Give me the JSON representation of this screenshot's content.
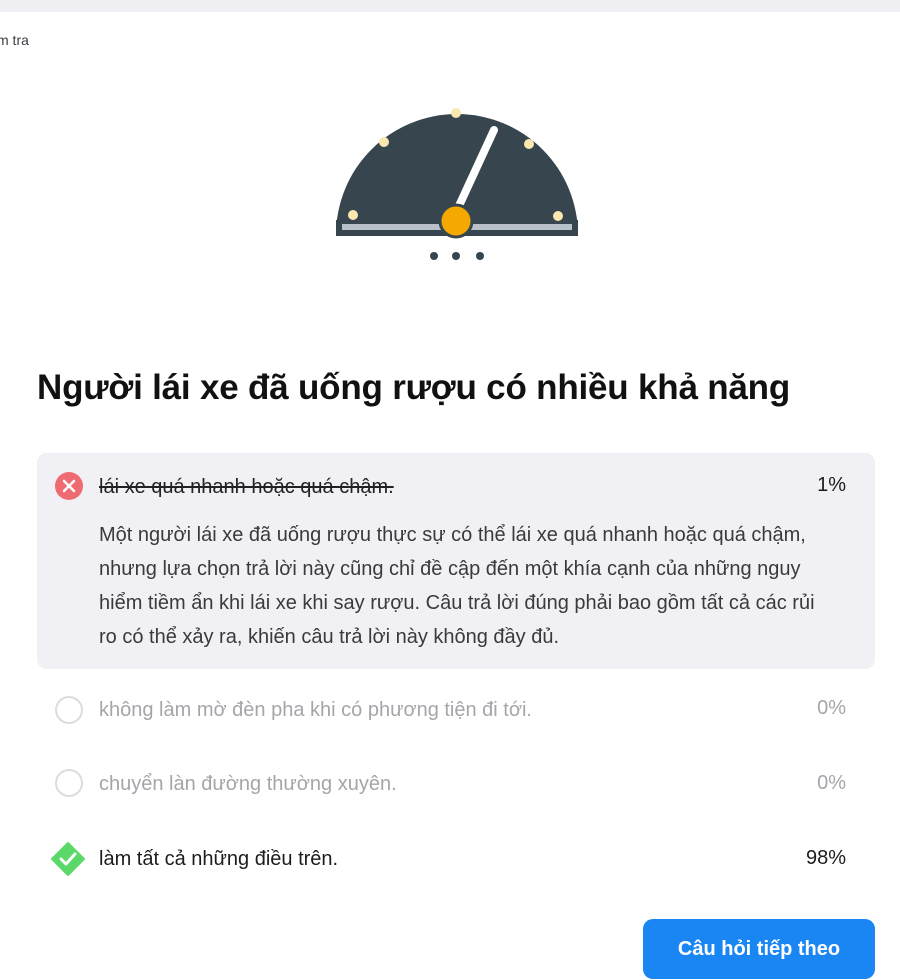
{
  "breadcrumb": "m tra",
  "question": "Người lái xe đã uống rượu có nhiều khả năng",
  "options": [
    {
      "text": "lái xe quá nhanh hoặc quá chậm.",
      "percent": "1%",
      "state": "incorrect-selected",
      "icon": "x-circle-icon",
      "explanation": "Một người lái xe đã uống rượu thực sự có thể lái xe quá nhanh hoặc quá chậm, nhưng lựa chọn trả lời này cũng chỉ đề cập đến một khía cạnh của những nguy hiểm tiềm ẩn khi lái xe khi say rượu. Câu trả lời đúng phải bao gồm tất cả các rủi ro có thể xảy ra, khiến câu trả lời này không đầy đủ."
    },
    {
      "text": "không làm mờ đèn pha khi có phương tiện đi tới.",
      "percent": "0%",
      "state": "unselected",
      "icon": "empty-circle-icon"
    },
    {
      "text": "chuyển làn đường thường xuyên.",
      "percent": "0%",
      "state": "unselected",
      "icon": "empty-circle-icon"
    },
    {
      "text": "làm tất cả những điều trên.",
      "percent": "98%",
      "state": "correct",
      "icon": "check-diamond-icon"
    }
  ],
  "next_button": "Câu hỏi tiếp theo",
  "colors": {
    "gauge_body": "#37454f",
    "gauge_accent": "#f5a800",
    "incorrect": "#ef6b72",
    "correct": "#5ad969",
    "button": "#1a86f4"
  }
}
